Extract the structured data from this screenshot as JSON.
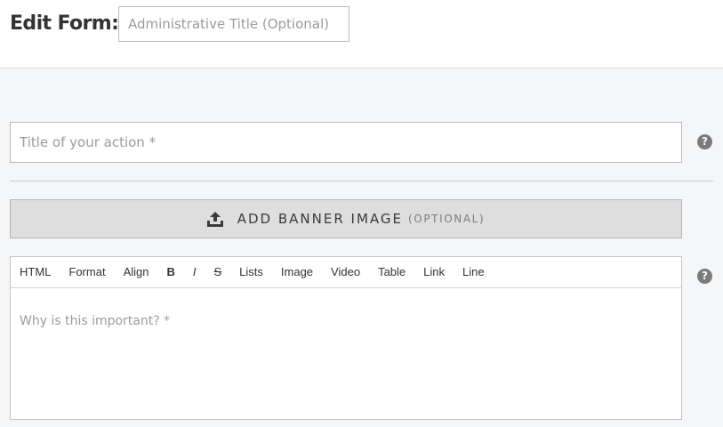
{
  "header": {
    "title": "Edit Form:",
    "admin_title_placeholder": "Administrative Title (Optional)"
  },
  "action_title": {
    "placeholder": "Title of your action *"
  },
  "help_glyph": "?",
  "banner": {
    "label": "ADD BANNER IMAGE",
    "optional": "(OPTIONAL)",
    "icon": "upload-icon"
  },
  "editor": {
    "toolbar": {
      "html": "HTML",
      "format": "Format",
      "align": "Align",
      "bold": "B",
      "italic": "I",
      "strike": "S",
      "lists": "Lists",
      "image": "Image",
      "video": "Video",
      "table": "Table",
      "link": "Link",
      "line": "Line"
    },
    "placeholder": "Why is this important? *"
  },
  "colors": {
    "page_bg": "#f5f6f8",
    "banner_bg": "#dedede",
    "help_bg": "#7b7b7b"
  }
}
